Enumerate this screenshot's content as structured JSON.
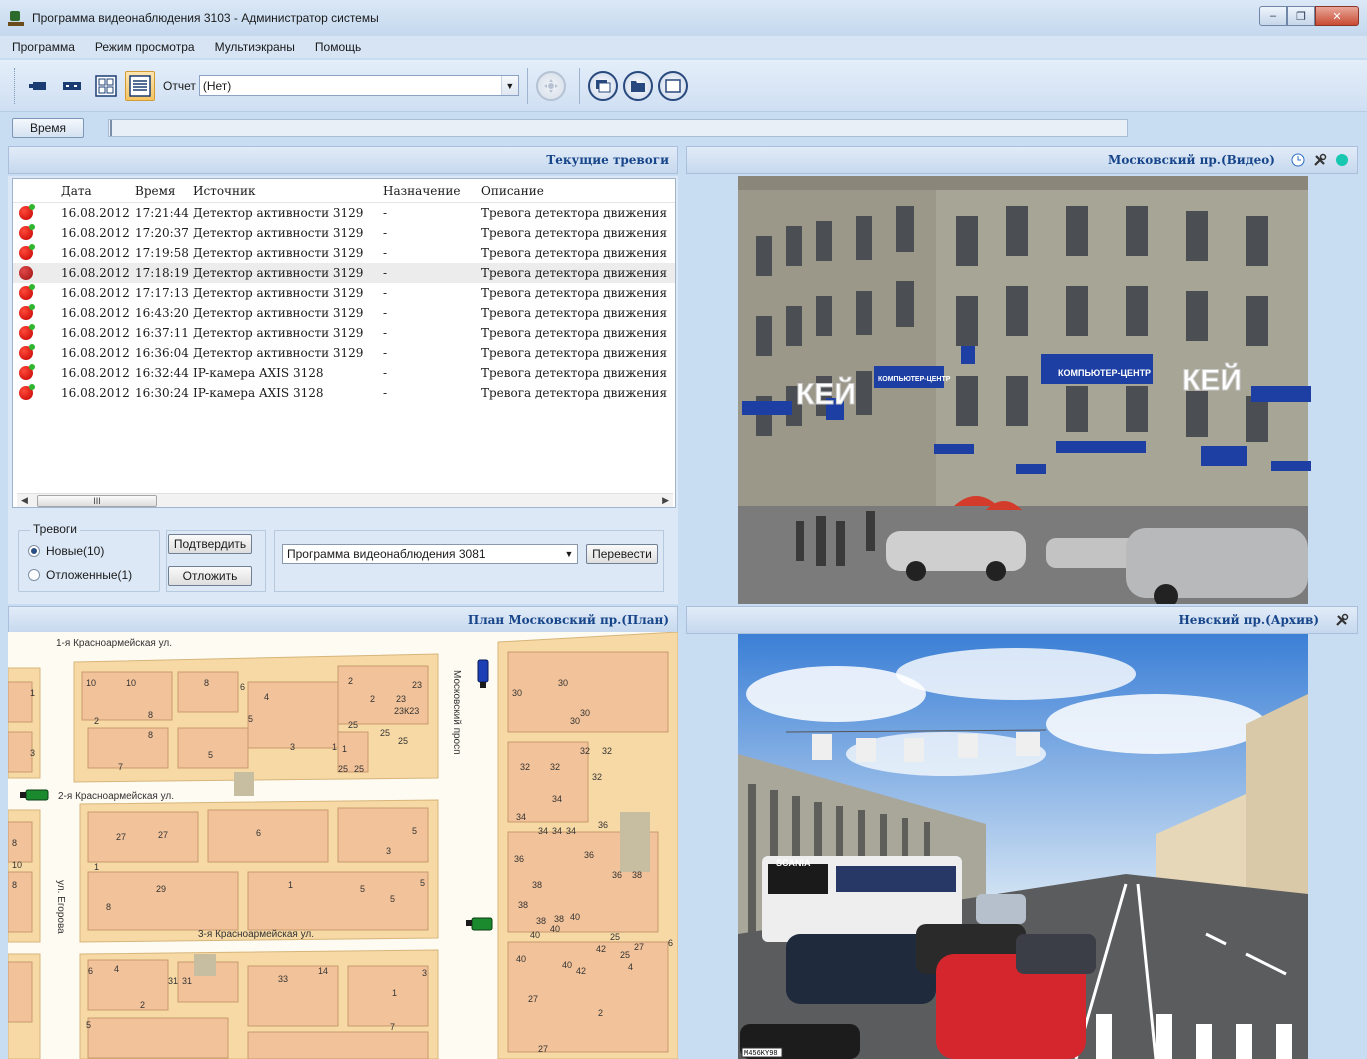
{
  "window": {
    "title": "Программа видеонаблюдения 3103 - Администратор системы",
    "buttons": {
      "minimize": "‒",
      "maximize": "❐",
      "close": "✕"
    }
  },
  "menu": [
    "Программа",
    "Режим просмотра",
    "Мультиэкраны",
    "Помощь"
  ],
  "toolbar": {
    "report_label": "Отчет",
    "report_value": "(Нет)",
    "icons": [
      "camera-icon",
      "dual-view-icon",
      "grid-layout-icon",
      "list-view-icon",
      "ptz-control-icon",
      "multi-window-icon",
      "folder-window-icon",
      "single-window-icon"
    ]
  },
  "time": {
    "button": "Время"
  },
  "alarms": {
    "header": "Текущие тревоги",
    "columns": [
      "Дата",
      "Время",
      "Источник",
      "Назначение",
      "Описание"
    ],
    "rows": [
      {
        "date": "16.08.2012",
        "time": "17:21:44",
        "source": "Детектор активности 3129",
        "dest": "-",
        "desc": "Тревога детектора движения"
      },
      {
        "date": "16.08.2012",
        "time": "17:20:37",
        "source": "Детектор активности 3129",
        "dest": "-",
        "desc": "Тревога детектора движения"
      },
      {
        "date": "16.08.2012",
        "time": "17:19:58",
        "source": "Детектор активности 3129",
        "dest": "-",
        "desc": "Тревога детектора движения"
      },
      {
        "date": "16.08.2012",
        "time": "17:18:19",
        "source": "Детектор активности 3129",
        "dest": "-",
        "desc": "Тревога детектора движения"
      },
      {
        "date": "16.08.2012",
        "time": "17:17:13",
        "source": "Детектор активности 3129",
        "dest": "-",
        "desc": "Тревога детектора движения"
      },
      {
        "date": "16.08.2012",
        "time": "16:43:20",
        "source": "Детектор активности 3129",
        "dest": "-",
        "desc": "Тревога детектора движения"
      },
      {
        "date": "16.08.2012",
        "time": "16:37:11",
        "source": "Детектор активности 3129",
        "dest": "-",
        "desc": "Тревога детектора движения"
      },
      {
        "date": "16.08.2012",
        "time": "16:36:04",
        "source": "Детектор активности 3129",
        "dest": "-",
        "desc": "Тревога детектора движения"
      },
      {
        "date": "16.08.2012",
        "time": "16:32:44",
        "source": "IP-камера AXIS 3128",
        "dest": "-",
        "desc": "Тревога детектора движения"
      },
      {
        "date": "16.08.2012",
        "time": "16:30:24",
        "source": "IP-камера AXIS 3128",
        "dest": "-",
        "desc": "Тревога детектора движения"
      }
    ],
    "group_label": "Тревоги",
    "filter_new": "Новые(10)",
    "filter_postponed": "Отложенные(1)",
    "confirm_button": "Подтвердить",
    "postpone_button": "Отложить",
    "target_program": "Программа видеонаблюдения 3081",
    "transfer_button": "Перевести",
    "scroll_grip": "III"
  },
  "panels": {
    "video1_title": "Московский пр.(Видео)",
    "plan_title": "План Московский пр.(План)",
    "archive_title": "Невский пр.(Архив)"
  },
  "video1_signs": {
    "store": "КЕЙ",
    "sign": "КОМПЬЮТЕР-ЦЕНТР",
    "sign2": "КОМПЬЮТЕР-ЦЕНТР"
  },
  "video2_signs": {
    "bus": "SCANIA",
    "plate": "M456KY98"
  },
  "map": {
    "streets": [
      "1-я Красноармейская ул.",
      "2-я Красноармейская ул.",
      "3-я Красноармейская ул.",
      "Московский просп",
      "ул. Егорова"
    ],
    "numbers": [
      "10",
      "10",
      "8",
      "6",
      "4",
      "2",
      "2",
      "23",
      "23",
      "23К23",
      "25",
      "25",
      "25",
      "5",
      "8",
      "8",
      "2",
      "1",
      "3",
      "7",
      "5",
      "3",
      "1",
      "1",
      "25",
      "25",
      "30",
      "30",
      "30",
      "30",
      "32",
      "32",
      "32",
      "32",
      "32",
      "34",
      "34",
      "34",
      "34",
      "34",
      "36",
      "36",
      "36",
      "36",
      "38",
      "38",
      "38",
      "38",
      "38",
      "40",
      "40",
      "40",
      "40",
      "40",
      "42",
      "42",
      "27",
      "27",
      "25",
      "25",
      "27",
      "6",
      "4",
      "2",
      "27",
      "27",
      "6",
      "5",
      "3",
      "1",
      "29",
      "1",
      "5",
      "5",
      "5",
      "8",
      "10",
      "8",
      "8",
      "6",
      "4",
      "2",
      "31",
      "31",
      "33",
      "14",
      "3",
      "1",
      "7",
      "5"
    ]
  },
  "colors": {
    "accent": "#17458a",
    "alarm": "#d40000",
    "panel_bg": "#c9ddf2"
  }
}
